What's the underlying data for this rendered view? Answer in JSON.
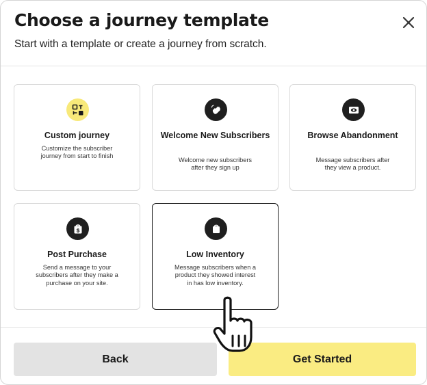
{
  "header": {
    "title": "Choose a journey template",
    "subtitle": "Start with a template or create a journey from scratch.",
    "close_icon": "close-icon"
  },
  "templates": [
    {
      "name": "Custom journey",
      "description": "Customize the subscriber journey from start to finish",
      "icon": "template-grid-icon",
      "icon_bg": "#f8e97a"
    },
    {
      "name": "Welcome New Subscribers",
      "description": "Welcome new subscribers after they sign up",
      "icon": "waving-hand-icon",
      "icon_bg": "#1f1f1f"
    },
    {
      "name": "Browse Abandonment",
      "description": "Message subscribers after they view a product.",
      "icon": "eye-icon",
      "icon_bg": "#1f1f1f"
    },
    {
      "name": "Post Purchase",
      "description": "Send a message to your subscribers after they make a purchase on your site.",
      "icon": "dollar-bag-icon",
      "icon_bg": "#1f1f1f"
    },
    {
      "name": "Low Inventory",
      "description": "Message subscribers when a product they showed interest in has low inventory.",
      "icon": "shopping-bag-icon",
      "icon_bg": "#1f1f1f",
      "selected": true
    }
  ],
  "footer": {
    "back_label": "Back",
    "start_label": "Get Started"
  },
  "colors": {
    "accent_yellow": "#faec82",
    "icon_yellow": "#f8e97a",
    "secondary_button": "#e3e3e3",
    "icon_dark": "#1f1f1f"
  }
}
